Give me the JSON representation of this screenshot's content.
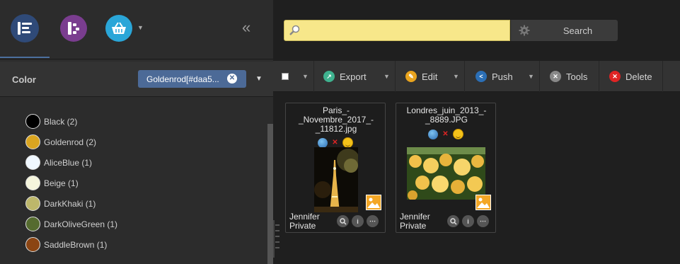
{
  "nav": {
    "collapse_glyph": "«"
  },
  "filter": {
    "label": "Color",
    "tag": "Goldenrod[#daa5...",
    "colors": [
      {
        "label": "Black (2)",
        "color": "#000000"
      },
      {
        "label": "Goldenrod (2)",
        "color": "#daa520"
      },
      {
        "label": "AliceBlue (1)",
        "color": "#f0f8ff"
      },
      {
        "label": "Beige (1)",
        "color": "#f5f5dc"
      },
      {
        "label": "DarkKhaki (1)",
        "color": "#bdb76b"
      },
      {
        "label": "DarkOliveGreen (1)",
        "color": "#556b2f"
      },
      {
        "label": "SaddleBrown (1)",
        "color": "#8b4513"
      }
    ]
  },
  "search": {
    "value": "",
    "button_label": "Search"
  },
  "toolbar": {
    "export_label": "Export",
    "edit_label": "Edit",
    "push_label": "Push",
    "tools_label": "Tools",
    "delete_label": "Delete"
  },
  "cards": [
    {
      "title": "Paris_-_Novembre_2017_-_11812.jpg",
      "owner": "Jennifer",
      "visibility": "Private"
    },
    {
      "title": "Londres_juin_2013_-_8889.JPG",
      "owner": "Jennifer",
      "visibility": "Private"
    }
  ],
  "colors": {
    "accent": "#4c6a97",
    "search_bg": "#f7e78a",
    "delete": "#e02424"
  }
}
